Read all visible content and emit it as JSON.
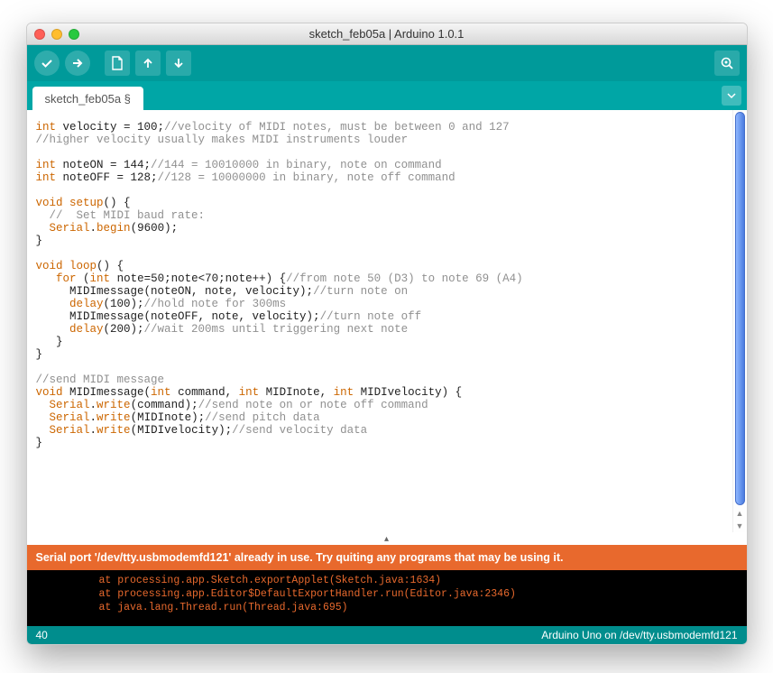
{
  "window": {
    "title": "sketch_feb05a | Arduino 1.0.1"
  },
  "tab": {
    "name": "sketch_feb05a §"
  },
  "code": {
    "l01a": "int",
    "l01b": " velocity = 100;",
    "l01c": "//velocity of MIDI notes, must be between 0 and 127",
    "l02": "//higher velocity usually makes MIDI instruments louder",
    "l04a": "int",
    "l04b": " noteON = 144;",
    "l04c": "//144 = 10010000 in binary, note on command",
    "l05a": "int",
    "l05b": " noteOFF = 128;",
    "l05c": "//128 = 10000000 in binary, note off command",
    "l07a": "void",
    "l07b": " ",
    "l07c": "setup",
    "l07d": "() {",
    "l08": "  //  Set MIDI baud rate:",
    "l09a": "  ",
    "l09b": "Serial",
    "l09c": ".",
    "l09d": "begin",
    "l09e": "(9600);",
    "l10": "}",
    "l12a": "void",
    "l12b": " ",
    "l12c": "loop",
    "l12d": "() {",
    "l13a": "   ",
    "l13b": "for",
    "l13c": " (",
    "l13d": "int",
    "l13e": " note=50;note<70;note++) {",
    "l13f": "//from note 50 (D3) to note 69 (A4)",
    "l14a": "     MIDImessage(noteON, note, velocity);",
    "l14b": "//turn note on",
    "l15a": "     ",
    "l15b": "delay",
    "l15c": "(100);",
    "l15d": "//hold note for 300ms",
    "l16a": "     MIDImessage(noteOFF, note, velocity);",
    "l16b": "//turn note off",
    "l17a": "     ",
    "l17b": "delay",
    "l17c": "(200);",
    "l17d": "//wait 200ms until triggering next note",
    "l18": "   }",
    "l19": "}",
    "l21": "//send MIDI message",
    "l22a": "void",
    "l22b": " MIDImessage(",
    "l22c": "int",
    "l22d": " command, ",
    "l22e": "int",
    "l22f": " MIDInote, ",
    "l22g": "int",
    "l22h": " MIDIvelocity) {",
    "l23a": "  ",
    "l23b": "Serial",
    "l23c": ".",
    "l23d": "write",
    "l23e": "(command);",
    "l23f": "//send note on or note off command",
    "l24a": "  ",
    "l24b": "Serial",
    "l24c": ".",
    "l24d": "write",
    "l24e": "(MIDInote);",
    "l24f": "//send pitch data",
    "l25a": "  ",
    "l25b": "Serial",
    "l25c": ".",
    "l25d": "write",
    "l25e": "(MIDIvelocity);",
    "l25f": "//send velocity data",
    "l26": "}"
  },
  "error": {
    "message": "Serial port '/dev/tty.usbmodemfd121' already in use. Try quiting any programs that may be using it."
  },
  "console": {
    "l1": "at processing.app.Sketch.exportApplet(Sketch.java:1634)",
    "l2": "at processing.app.Editor$DefaultExportHandler.run(Editor.java:2346)",
    "l3": "at java.lang.Thread.run(Thread.java:695)"
  },
  "footer": {
    "line": "40",
    "board": "Arduino Uno on /dev/tty.usbmodemfd121"
  }
}
